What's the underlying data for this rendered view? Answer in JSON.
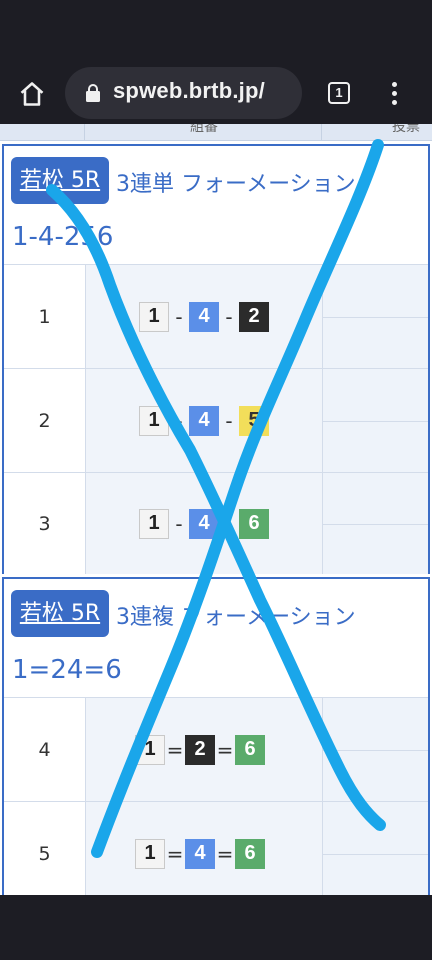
{
  "browser": {
    "url": "spweb.brtb.jp/",
    "tab_count": "1"
  },
  "table_header": {
    "col2_partial": "組番",
    "col3_partial": "投票"
  },
  "cards": [
    {
      "venue": "若松 5R",
      "bet_type": "3連単 フォーメーション",
      "combination": "1-4-256",
      "rows": [
        {
          "index": "1",
          "a": "1",
          "sep1": "-",
          "b": "4",
          "sep2": "-",
          "c": "2"
        },
        {
          "index": "2",
          "a": "1",
          "sep1": "-",
          "b": "4",
          "sep2": "-",
          "c": "5"
        },
        {
          "index": "3",
          "a": "1",
          "sep1": "-",
          "b": "4",
          "sep2": "-",
          "c": "6"
        }
      ]
    },
    {
      "venue": "若松 5R",
      "bet_type": "3連複 フォーメーション",
      "combination": "1=24=6",
      "rows": [
        {
          "index": "4",
          "a": "1",
          "sep1": "=",
          "b": "2",
          "sep2": "=",
          "c": "6"
        },
        {
          "index": "5",
          "a": "1",
          "sep1": "=",
          "b": "4",
          "sep2": "=",
          "c": "6"
        }
      ]
    }
  ],
  "colors": {
    "accent": "#3a6cc6",
    "boat_1": "#f4f4f4",
    "boat_2": "#2b2b2b",
    "boat_4": "#5b8fe8",
    "boat_5": "#f2de5a",
    "boat_6": "#5aab6b",
    "annotation_stroke": "#1aa6ea"
  },
  "icons": {
    "home": "home-icon",
    "lock": "lock-icon",
    "tabs": "tab-switcher-icon",
    "menu": "more-vert-icon"
  }
}
